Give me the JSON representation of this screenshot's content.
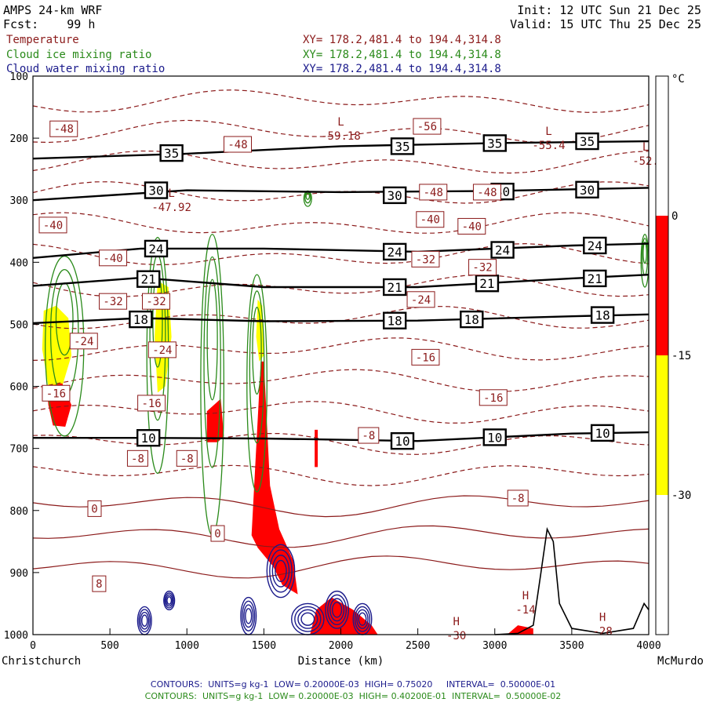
{
  "header": {
    "model": "AMPS 24-km WRF",
    "fcst_label": "Fcst:",
    "fcst_value": "99 h",
    "init": "Init: 12 UTC Sun 21 Dec 25",
    "valid": "Valid: 15 UTC Thu 25 Dec 25"
  },
  "fields": [
    {
      "name": "Temperature",
      "xy": "XY= 178.2,481.4 to 194.4,314.8",
      "color": "#8b1a1a"
    },
    {
      "name": "Cloud ice mixing ratio",
      "xy": "XY= 178.2,481.4 to 194.4,314.8",
      "color": "#2a8a1a"
    },
    {
      "name": "Cloud water mixing ratio",
      "xy": "XY= 178.2,481.4 to 194.4,314.8",
      "color": "#1a1a8b"
    }
  ],
  "footer": {
    "line1": "CONTOURS:  UNITS=g kg-1  LOW= 0.20000E-03  HIGH= 0.75020     INTERVAL=  0.50000E-01",
    "line2": "CONTOURS:  UNITS=g kg-1  LOW= 0.20000E-03  HIGH= 0.40200E-01  INTERVAL=  0.50000E-02",
    "line1_color": "#1a1a8b",
    "line2_color": "#2a8a1a"
  },
  "chart_data": {
    "type": "cross-section",
    "xlabel": "Distance (km)",
    "ylabel": "",
    "x_left_label": "Christchurch",
    "x_right_label": "McMurdo",
    "xlim": [
      0,
      4000
    ],
    "ylim": [
      1000,
      100
    ],
    "x_ticks": [
      "0",
      "500",
      "1000",
      "1500",
      "2000",
      "2500",
      "3000",
      "3500",
      "4000"
    ],
    "y_ticks": [
      "100",
      "200",
      "300",
      "400",
      "500",
      "600",
      "700",
      "800",
      "900",
      "1000"
    ],
    "colorbar": {
      "unit": "°C",
      "tick_labels": [
        "0",
        "-15",
        "-30"
      ],
      "bands": [
        {
          "from": -30,
          "to": -15,
          "color": "#ffff00"
        },
        {
          "from": -15,
          "to": 0,
          "color": "#ff0000"
        }
      ]
    },
    "isotachs": [
      {
        "label": "35",
        "points": [
          [
            0,
            233
          ],
          [
            1000,
            225
          ],
          [
            2000,
            213
          ],
          [
            3000,
            208
          ],
          [
            4000,
            205
          ]
        ],
        "boxes": [
          [
            900,
            224
          ],
          [
            2400,
            213
          ],
          [
            3000,
            208
          ],
          [
            3600,
            205
          ]
        ]
      },
      {
        "label": "30",
        "points": [
          [
            0,
            300
          ],
          [
            1000,
            284
          ],
          [
            2000,
            287
          ],
          [
            3000,
            285
          ],
          [
            4000,
            280
          ]
        ],
        "boxes": [
          [
            800,
            284
          ],
          [
            2350,
            292
          ],
          [
            3050,
            286
          ],
          [
            3600,
            283
          ]
        ]
      },
      {
        "label": "24",
        "points": [
          [
            0,
            393
          ],
          [
            700,
            378
          ],
          [
            1500,
            378
          ],
          [
            2500,
            383
          ],
          [
            3500,
            373
          ],
          [
            4000,
            370
          ]
        ],
        "boxes": [
          [
            800,
            378
          ],
          [
            2350,
            383
          ],
          [
            3050,
            380
          ],
          [
            3650,
            373
          ]
        ]
      },
      {
        "label": "21",
        "points": [
          [
            0,
            438
          ],
          [
            700,
            425
          ],
          [
            1500,
            440
          ],
          [
            2500,
            440
          ],
          [
            3500,
            426
          ],
          [
            4000,
            420
          ]
        ],
        "boxes": [
          [
            750,
            427
          ],
          [
            2350,
            440
          ],
          [
            2950,
            434
          ],
          [
            3650,
            426
          ]
        ]
      },
      {
        "label": "18",
        "points": [
          [
            0,
            498
          ],
          [
            700,
            490
          ],
          [
            1500,
            495
          ],
          [
            2500,
            494
          ],
          [
            3500,
            487
          ],
          [
            4000,
            484
          ]
        ],
        "boxes": [
          [
            700,
            492
          ],
          [
            2350,
            494
          ],
          [
            2850,
            492
          ],
          [
            3700,
            485
          ]
        ]
      },
      {
        "label": "10",
        "points": [
          [
            0,
            683
          ],
          [
            700,
            683
          ],
          [
            1500,
            684
          ],
          [
            2500,
            688
          ],
          [
            3500,
            676
          ],
          [
            4000,
            674
          ]
        ],
        "boxes": [
          [
            750,
            683
          ],
          [
            2400,
            688
          ],
          [
            3000,
            682
          ],
          [
            3700,
            675
          ]
        ]
      }
    ],
    "temperature_labels": [
      {
        "text": "-48",
        "x": 200,
        "p": 185
      },
      {
        "text": "-48",
        "x": 1330,
        "p": 210
      },
      {
        "text": "-56",
        "x": 2560,
        "p": 181
      },
      {
        "text": "-48",
        "x": 2600,
        "p": 287
      },
      {
        "text": "-48",
        "x": 2950,
        "p": 287
      },
      {
        "text": "-40",
        "x": 130,
        "p": 340
      },
      {
        "text": "-40",
        "x": 520,
        "p": 393
      },
      {
        "text": "-40",
        "x": 2580,
        "p": 331
      },
      {
        "text": "-40",
        "x": 2850,
        "p": 342
      },
      {
        "text": "-32",
        "x": 2550,
        "p": 395
      },
      {
        "text": "-32",
        "x": 2920,
        "p": 408
      },
      {
        "text": "-32",
        "x": 520,
        "p": 463
      },
      {
        "text": "-32",
        "x": 800,
        "p": 463
      },
      {
        "text": "-24",
        "x": 2520,
        "p": 460
      },
      {
        "text": "-24",
        "x": 330,
        "p": 527
      },
      {
        "text": "-24",
        "x": 840,
        "p": 541
      },
      {
        "text": "-16",
        "x": 2550,
        "p": 553
      },
      {
        "text": "-16",
        "x": 2990,
        "p": 618
      },
      {
        "text": "-16",
        "x": 150,
        "p": 611
      },
      {
        "text": "-16",
        "x": 770,
        "p": 627
      },
      {
        "text": "-8",
        "x": 2180,
        "p": 679
      },
      {
        "text": "-8",
        "x": 3150,
        "p": 780
      },
      {
        "text": "-8",
        "x": 680,
        "p": 716
      },
      {
        "text": "-8",
        "x": 1000,
        "p": 716
      },
      {
        "text": "0",
        "x": 400,
        "p": 797
      },
      {
        "text": "0",
        "x": 1200,
        "p": 837
      },
      {
        "text": "8",
        "x": 430,
        "p": 918
      }
    ],
    "extrema": [
      {
        "kind": "L",
        "value": "-59.18",
        "x": 2000,
        "p": 190
      },
      {
        "kind": "L",
        "value": "-55.4",
        "x": 3350,
        "p": 205
      },
      {
        "kind": "L",
        "value": "-52.",
        "x": 3980,
        "p": 230
      },
      {
        "kind": "L",
        "value": "-47.92",
        "x": 900,
        "p": 305
      },
      {
        "kind": "H",
        "value": "-14",
        "x": 3200,
        "p": 953
      },
      {
        "kind": "H",
        "value": "-30",
        "x": 2750,
        "p": 995
      },
      {
        "kind": "H",
        "value": "-28",
        "x": 3700,
        "p": 988
      }
    ],
    "shading": [
      {
        "color": "#ffff00",
        "points": [
          [
            70,
            478
          ],
          [
            150,
            470
          ],
          [
            230,
            490
          ],
          [
            250,
            550
          ],
          [
            190,
            600
          ],
          [
            100,
            600
          ],
          [
            60,
            540
          ]
        ]
      },
      {
        "color": "#ff0000",
        "points": [
          [
            90,
            600
          ],
          [
            190,
            595
          ],
          [
            250,
            630
          ],
          [
            210,
            665
          ],
          [
            130,
            663
          ],
          [
            100,
            630
          ]
        ]
      },
      {
        "color": "#ffff00",
        "points": [
          [
            810,
            430
          ],
          [
            880,
            440
          ],
          [
            900,
            520
          ],
          [
            860,
            600
          ],
          [
            810,
            610
          ],
          [
            790,
            520
          ]
        ]
      },
      {
        "color": "#ffff00",
        "points": [
          [
            1460,
            460
          ],
          [
            1490,
            470
          ],
          [
            1500,
            550
          ],
          [
            1470,
            560
          ],
          [
            1450,
            520
          ]
        ]
      },
      {
        "color": "#ff0000",
        "points": [
          [
            1480,
            560
          ],
          [
            1500,
            560
          ],
          [
            1540,
            760
          ],
          [
            1600,
            830
          ],
          [
            1690,
            880
          ],
          [
            1720,
            935
          ],
          [
            1620,
            920
          ],
          [
            1560,
            890
          ],
          [
            1460,
            860
          ],
          [
            1420,
            840
          ]
        ]
      },
      {
        "color": "#ff0000",
        "points": [
          [
            1130,
            640
          ],
          [
            1220,
            620
          ],
          [
            1240,
            680
          ],
          [
            1200,
            690
          ],
          [
            1130,
            690
          ]
        ]
      },
      {
        "color": "#ff0000",
        "points": [
          [
            1840,
            960
          ],
          [
            1940,
            940
          ],
          [
            2080,
            960
          ],
          [
            2200,
            985
          ],
          [
            2240,
            1000
          ],
          [
            1800,
            1000
          ]
        ]
      },
      {
        "color": "#ff0000",
        "points": [
          [
            3080,
            1000
          ],
          [
            3150,
            985
          ],
          [
            3250,
            990
          ],
          [
            3250,
            1000
          ]
        ]
      },
      {
        "color": "#ff0000",
        "points": [
          [
            1830,
            670
          ],
          [
            1850,
            670
          ],
          [
            1850,
            730
          ],
          [
            1830,
            730
          ]
        ]
      }
    ],
    "cloud_ice_columns": [
      {
        "x": [
          80,
          330
        ],
        "p": [
          390,
          680
        ]
      },
      {
        "x": [
          740,
          880
        ],
        "p": [
          360,
          740
        ]
      },
      {
        "x": [
          1090,
          1240
        ],
        "p": [
          355,
          840
        ]
      },
      {
        "x": [
          1390,
          1520
        ],
        "p": [
          420,
          770
        ]
      },
      {
        "x": [
          1760,
          1810
        ],
        "p": [
          285,
          310
        ]
      },
      {
        "x": [
          3950,
          4000
        ],
        "p": [
          355,
          440
        ]
      }
    ],
    "cloud_water_blobs": [
      {
        "x": [
          680,
          770
        ],
        "p": [
          955,
          1000
        ]
      },
      {
        "x": [
          850,
          920
        ],
        "p": [
          930,
          960
        ]
      },
      {
        "x": [
          1350,
          1450
        ],
        "p": [
          940,
          1000
        ]
      },
      {
        "x": [
          1520,
          1700
        ],
        "p": [
          855,
          940
        ]
      },
      {
        "x": [
          1680,
          1890
        ],
        "p": [
          950,
          1000
        ]
      },
      {
        "x": [
          1900,
          2050
        ],
        "p": [
          930,
          990
        ]
      },
      {
        "x": [
          2080,
          2200
        ],
        "p": [
          950,
          1000
        ]
      }
    ],
    "terrain": [
      [
        3000,
        1000
      ],
      [
        3150,
        998
      ],
      [
        3250,
        985
      ],
      [
        3300,
        900
      ],
      [
        3340,
        830
      ],
      [
        3380,
        850
      ],
      [
        3420,
        950
      ],
      [
        3500,
        990
      ],
      [
        3700,
        998
      ],
      [
        3900,
        990
      ],
      [
        3970,
        950
      ],
      [
        4000,
        960
      ]
    ]
  }
}
